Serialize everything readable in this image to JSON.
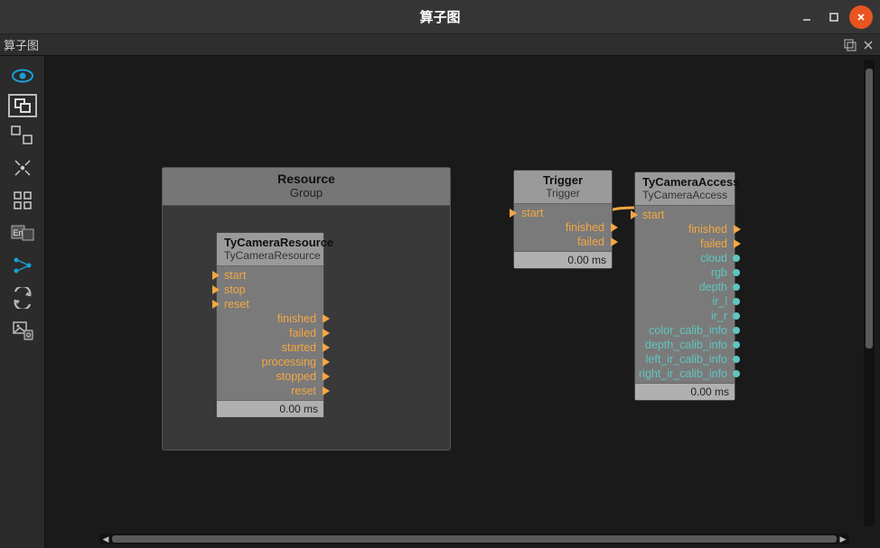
{
  "window": {
    "title": "算子图"
  },
  "tab": {
    "label": "算子图"
  },
  "group": {
    "title": "Resource",
    "subtitle": "Group"
  },
  "nodes": {
    "camera_resource": {
      "title": "TyCameraResource",
      "subtitle": "TyCameraResource",
      "inputs": [
        "start",
        "stop",
        "reset"
      ],
      "outputs": [
        "finished",
        "failed",
        "started",
        "processing",
        "stopped",
        "reset"
      ],
      "timing": "0.00 ms"
    },
    "trigger": {
      "title": "Trigger",
      "subtitle": "Trigger",
      "inputs": [
        "start"
      ],
      "outputs": [
        "finished",
        "failed"
      ],
      "timing": "0.00 ms"
    },
    "camera_access": {
      "title": "TyCameraAccess",
      "subtitle": "TyCameraAccess",
      "inputs": [
        "start"
      ],
      "outputs_trigger": [
        "finished",
        "failed"
      ],
      "outputs_data": [
        "cloud",
        "rgb",
        "depth",
        "ir_l",
        "ir_r",
        "color_calib_info",
        "depth_calib_info",
        "left_ir_calib_info",
        "right_ir_calib_info"
      ],
      "timing": "0.00 ms"
    }
  }
}
